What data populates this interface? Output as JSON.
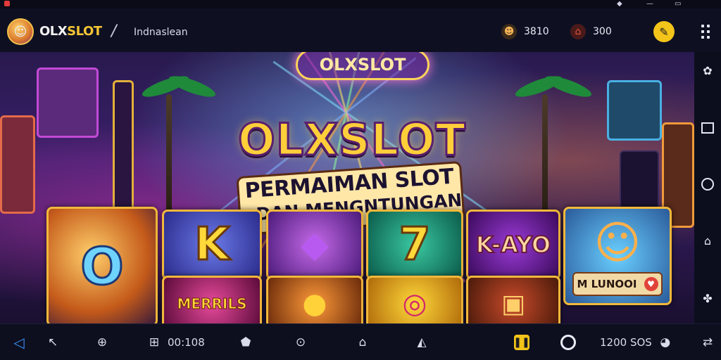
{
  "header": {
    "brand_prefix": "OLX",
    "brand_suffix": "SLOT",
    "divider": "/",
    "site_name": "Indnaslean",
    "stat_1": "3810",
    "stat_2": "300"
  },
  "hero": {
    "neon_sign": "OLXSLOT",
    "title": "OLXSLOT",
    "subtitle_line_1": "PERMAIMAN SLOT",
    "subtitle_line_2": "DAN MENGNTUNGAN",
    "tile_k": "K",
    "tile_7": "7",
    "tile_kayo": "K-AYO",
    "tile_merrils": "MERRILS",
    "tile_label": "M LUNOOI"
  },
  "bottom_bar": {
    "counter": "00:108",
    "balance": "1200 SOS"
  },
  "colors": {
    "accent": "#f3c419",
    "background": "#0b0d1c",
    "back_arrow": "#3b8cf0"
  }
}
